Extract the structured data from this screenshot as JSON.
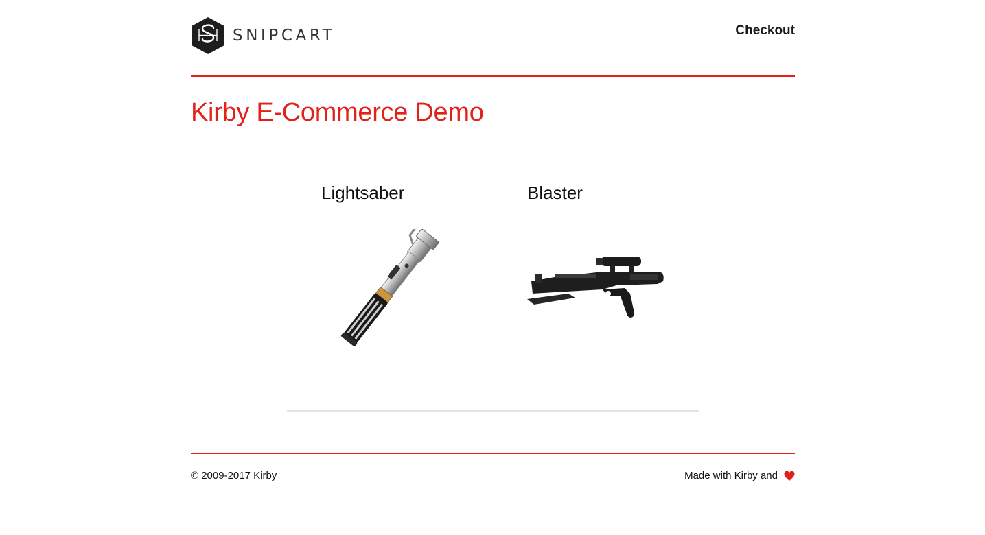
{
  "header": {
    "logo_text": "SNIPCART",
    "checkout_label": "Checkout"
  },
  "main": {
    "title": "Kirby E-Commerce Demo",
    "products": [
      {
        "name": "Lightsaber",
        "image_icon": "lightsaber-image"
      },
      {
        "name": "Blaster",
        "image_icon": "blaster-image"
      }
    ]
  },
  "footer": {
    "copyright": "© 2009-2017 Kirby",
    "made_with": "Made with Kirby and",
    "heart_icon": "heart-icon"
  },
  "colors": {
    "accent": "#e3211b",
    "divider": "#e2e2e2",
    "text": "#111111"
  }
}
